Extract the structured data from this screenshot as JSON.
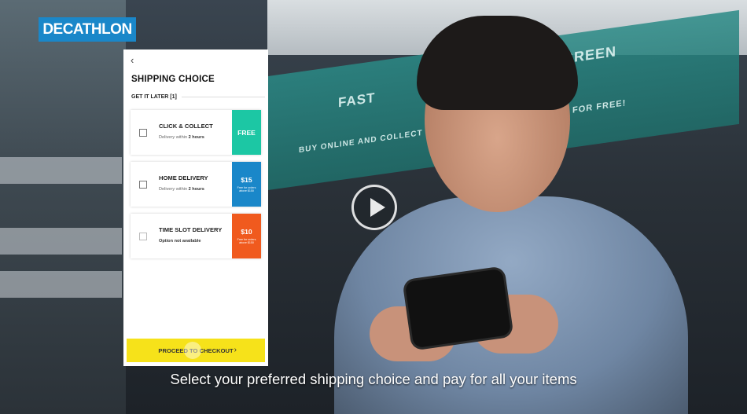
{
  "brand": {
    "logo_text": "DECATHLON",
    "logo_color": "#1A87C9"
  },
  "app": {
    "back_icon": "chevron-left-icon",
    "title": "SHIPPING CHOICE",
    "subheading": "GET IT LATER [1]",
    "options": [
      {
        "title": "CLICK & COLLECT",
        "subtitle_prefix": "Delivery within ",
        "subtitle_bold": "2 hours",
        "tag": "FREE",
        "tag_note": "",
        "tag_color": "#1CC7A4"
      },
      {
        "title": "HOME DELIVERY",
        "subtitle_prefix": "Delivery within ",
        "subtitle_bold": "2 hours",
        "tag": "$15",
        "tag_note": "Free for orders above $150",
        "tag_color": "#1A87C9"
      },
      {
        "title": "TIME SLOT DELIVERY",
        "subtitle_prefix": "",
        "subtitle_bold": "Option not available",
        "tag": "$10",
        "tag_note": "Free for orders above $150",
        "tag_color": "#F05A1E"
      }
    ],
    "cta_label": "PROCEED TO CHECKOUT",
    "cta_icon": "chevron-right-icon",
    "cta_color": "#F6E21A"
  },
  "video": {
    "play_icon": "play-icon",
    "caption": "Select your preferred shipping choice and pay for all your items"
  },
  "background_sign": {
    "line1": "FAST",
    "line2": "BUY ONLINE AND COLLECT",
    "line3": "GREEN",
    "line4": "FOR FREE!"
  }
}
